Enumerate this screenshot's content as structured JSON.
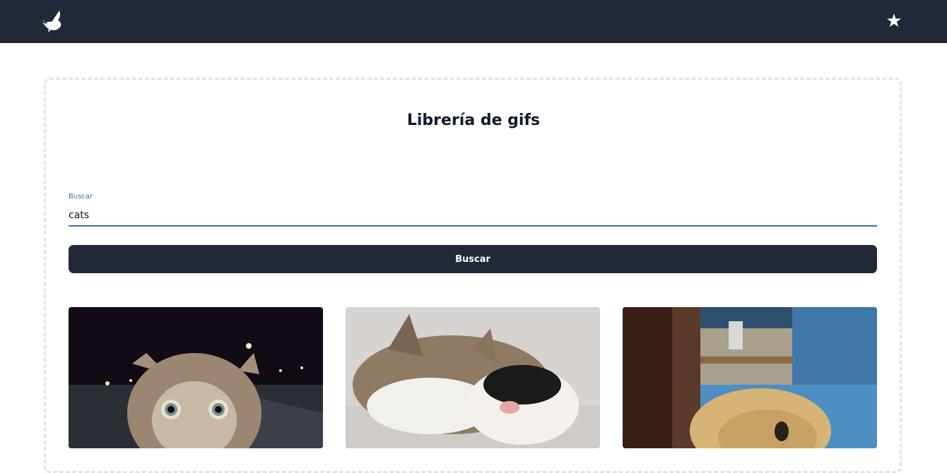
{
  "navbar": {
    "logo_icon": "dove-icon",
    "favorites_icon": "star-icon",
    "favorites_glyph": "★",
    "background_color": "#212837"
  },
  "main": {
    "title": "Librería de gifs",
    "search": {
      "label": "Buscar",
      "value": "cats",
      "accent_color": "#3b6cc7"
    },
    "search_button_label": "Buscar"
  },
  "results": [
    {
      "alt": "kitten in night street gif"
    },
    {
      "alt": "cats cuddling gif"
    },
    {
      "alt": "plush toy in room gif"
    }
  ]
}
